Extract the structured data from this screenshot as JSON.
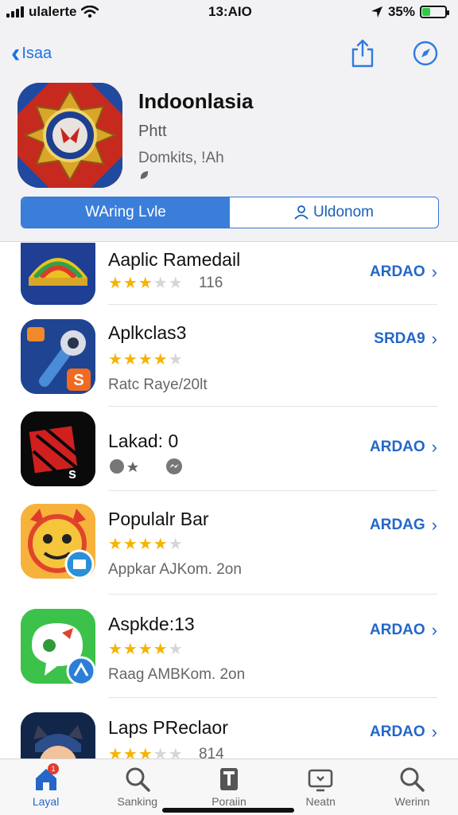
{
  "status_bar": {
    "carrier": "ulalerte",
    "time": "13:AIO",
    "battery": "35%",
    "battery_level": 0.35
  },
  "nav": {
    "back_label": "Isaa",
    "icons": [
      "chevron-left-icon",
      "share-icon",
      "compass-icon"
    ]
  },
  "app": {
    "title": "Indoonlasia",
    "subtitle": "Phtt",
    "developer": "Domkits, !Ah"
  },
  "segmented": {
    "active_label": "WAring Lvle",
    "inactive_label": "Uldonom"
  },
  "list": [
    {
      "name": "Aaplic Ramedail",
      "rating": 2.5,
      "meta": "116",
      "action": "ARDAO"
    },
    {
      "name": "Aplkclas3",
      "rating": 4.5,
      "meta": "Ratc Raye/20lt",
      "action": "SRDA9"
    },
    {
      "name": "Lakad: 0",
      "rating": 0,
      "meta": "",
      "action": "ARDAO"
    },
    {
      "name": "Populalr Bar",
      "rating": 4.5,
      "meta": "Appkar AJKom. 2on",
      "action": "ARDAG"
    },
    {
      "name": "Aspkde:13",
      "rating": 4.5,
      "meta": "Raag AMBKom. 2on",
      "action": "ARDAO"
    },
    {
      "name": "Laps PReclaor",
      "rating": 2.5,
      "meta": "814",
      "action": "ARDAO"
    }
  ],
  "tabbar": {
    "tabs": [
      {
        "label": "Layal",
        "icon": "home-icon"
      },
      {
        "label": "Sanking",
        "icon": "search-icon"
      },
      {
        "label": "Poraiin",
        "icon": "book-icon"
      },
      {
        "label": "Neatn",
        "icon": "tv-icon"
      },
      {
        "label": "Werinn",
        "icon": "search-icon"
      }
    ],
    "badge": "1"
  },
  "colors": {
    "accent": "#2467c7",
    "star": "#f5b400",
    "segment_active": "#3a7ed9"
  }
}
